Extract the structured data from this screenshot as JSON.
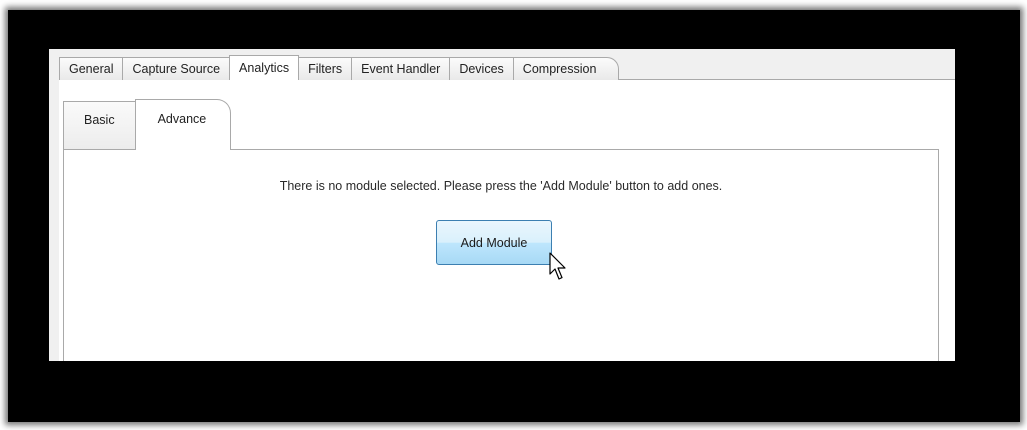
{
  "top_tabs": [
    {
      "label": "General"
    },
    {
      "label": "Capture Source"
    },
    {
      "label": "Analytics",
      "active": true
    },
    {
      "label": "Filters"
    },
    {
      "label": "Event Handler"
    },
    {
      "label": "Devices"
    },
    {
      "label": "Compression"
    }
  ],
  "sub_tabs": [
    {
      "label": "Basic"
    },
    {
      "label": "Advance",
      "active": true
    }
  ],
  "content": {
    "message": "There is no module selected. Please press the 'Add Module' button to add ones.",
    "add_module_label": "Add Module"
  },
  "cursor": {
    "icon": "arrow-cursor-icon"
  },
  "colors": {
    "button_border": "#3c7fb1",
    "button_fill": "#bee6fd",
    "tab_border": "#a9a9a9",
    "backdrop": "#000000"
  }
}
